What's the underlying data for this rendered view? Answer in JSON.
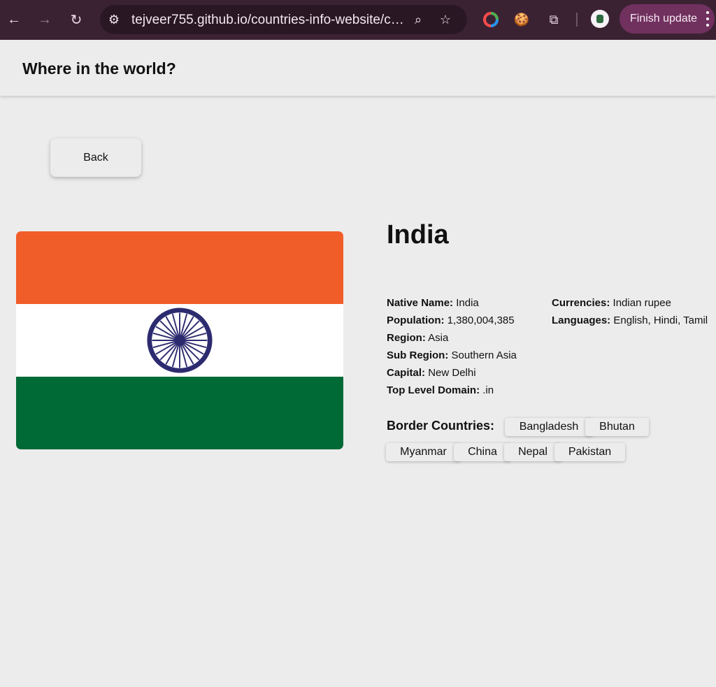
{
  "browser": {
    "url": "tejveer755.github.io/countries-info-website/cou...",
    "finish_update_label": "Finish update"
  },
  "site": {
    "title": "Where in the world?",
    "back_label": "Back"
  },
  "country": {
    "name": "India",
    "flag_colors": {
      "top": "#f15d29",
      "middle": "#ffffff",
      "bottom": "#006a37",
      "chakra": "#2d2b6f"
    },
    "left_details": [
      {
        "label": "Native Name:",
        "value": "India"
      },
      {
        "label": "Population:",
        "value": "1,380,004,385"
      },
      {
        "label": "Region:",
        "value": "Asia"
      },
      {
        "label": "Sub Region:",
        "value": "Southern Asia"
      },
      {
        "label": "Capital:",
        "value": "New Delhi"
      },
      {
        "label": "Top Level Domain:",
        "value": ".in"
      }
    ],
    "right_details": [
      {
        "label": "Currencies:",
        "value": "Indian rupee"
      },
      {
        "label": "Languages:",
        "value": "English, Hindi, Tamil"
      }
    ],
    "border_label": "Border Countries:",
    "border_countries": [
      "Bangladesh",
      "Bhutan",
      "Myanmar",
      "China",
      "Nepal",
      "Pakistan"
    ]
  }
}
